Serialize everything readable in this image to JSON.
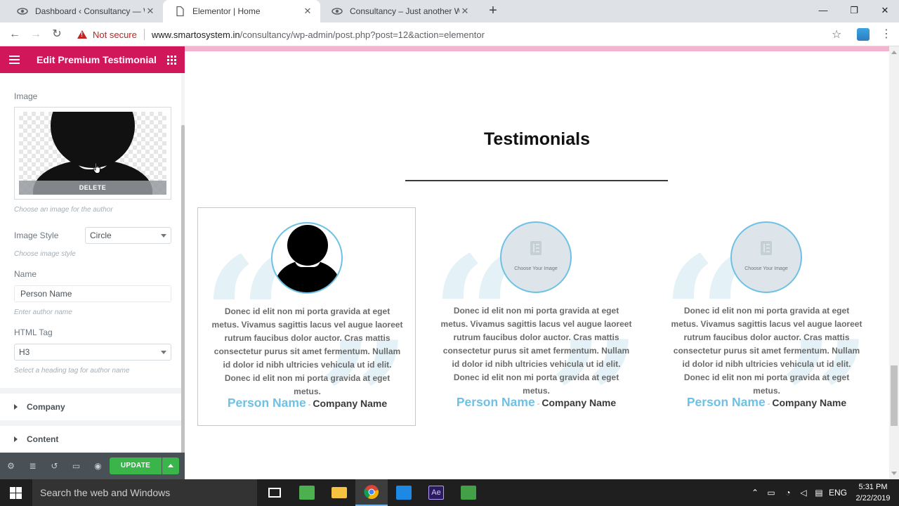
{
  "browser": {
    "tabs": [
      {
        "title": "Dashboard ‹ Consultancy — Wor",
        "active": false
      },
      {
        "title": "Elementor | Home",
        "active": true
      },
      {
        "title": "Consultancy – Just another Word",
        "active": false
      }
    ],
    "security_label": "Not secure",
    "url_host": "www.smartosystem.in",
    "url_path": "/consultancy/wp-admin/post.php?post=12&action=elementor"
  },
  "panel": {
    "title": "Edit Premium Testimonial",
    "image_label": "Image",
    "delete_label": "DELETE",
    "image_desc": "Choose an image for the author",
    "image_style_label": "Image Style",
    "image_style_value": "Circle",
    "image_style_desc": "Choose image style",
    "name_label": "Name",
    "name_value": "Person Name",
    "name_desc": "Enter author name",
    "html_tag_label": "HTML Tag",
    "html_tag_value": "H3",
    "html_tag_desc": "Select a heading tag for author name",
    "sections": [
      "Company",
      "Content"
    ],
    "update_label": "UPDATE",
    "accent": "#d1175a"
  },
  "preview": {
    "heading": "Testimonials",
    "cards": [
      {
        "text": "Donec id elit non mi porta gravida at eget metus. Vivamus sagittis lacus vel augue laoreet rutrum faucibus dolor auctor. Cras mattis consectetur purus sit amet fermentum. Nullam id dolor id nibh ultricies vehicula ut id elit. Donec id elit non mi porta gravida at eget metus.",
        "person": "Person Name",
        "separator": "-",
        "company": "Company Name",
        "image_caption": ""
      },
      {
        "text": "Donec id elit non mi porta gravida at eget metus. Vivamus sagittis lacus vel augue laoreet rutrum faucibus dolor auctor. Cras mattis consectetur purus sit amet fermentum. Nullam id dolor id nibh ultricies vehicula ut id elit. Donec id elit non mi porta gravida at eget metus.",
        "person": "Person Name",
        "separator": "-",
        "company": "Company Name",
        "image_caption": "Choose Your Image"
      },
      {
        "text": "Donec id elit non mi porta gravida at eget metus. Vivamus sagittis lacus vel augue laoreet rutrum faucibus dolor auctor. Cras mattis consectetur purus sit amet fermentum. Nullam id dolor id nibh ultricies vehicula ut id elit. Donec id elit non mi porta gravida at eget metus.",
        "person": "Person Name",
        "separator": "-",
        "company": "Company Name",
        "image_caption": "Choose Your Image"
      }
    ],
    "accent": "#6ec1e4"
  },
  "taskbar": {
    "search_placeholder": "Search the web and Windows",
    "language": "ENG",
    "time": "5:31 PM",
    "date": "2/22/2019"
  }
}
